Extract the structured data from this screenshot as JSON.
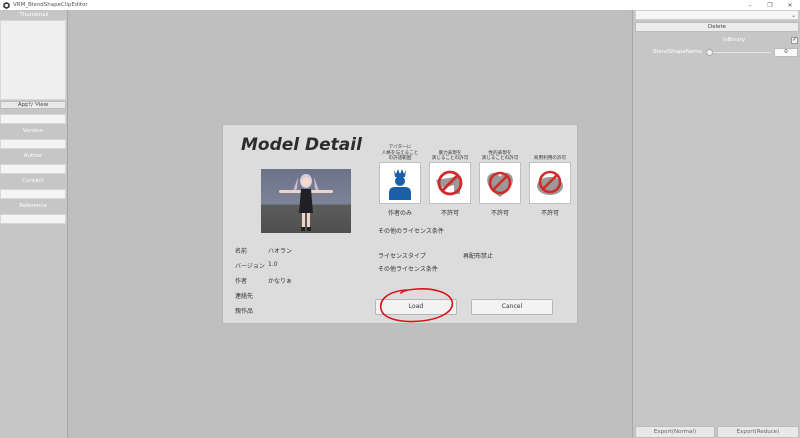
{
  "window": {
    "title": "VRM_BlendShapeClipEditor",
    "min": "–",
    "max": "❐",
    "close": "✕"
  },
  "left_panel": {
    "thumbnail_label": "Thumbnail",
    "apply_view": "Apply View",
    "fields": [
      "Title",
      "Version",
      "Author",
      "Contact",
      "Reference"
    ]
  },
  "right_panel": {
    "dropdown_value": "",
    "delete_label": "Delete",
    "is_binary_label": "IsBinary",
    "is_binary_checked": "✓",
    "blendshape_name_label": "BlendShapeName",
    "slider_value": "0",
    "export_normal": "Export(Normal)",
    "export_reduce": "Export(Reduce)"
  },
  "modal": {
    "title": "Model Detail",
    "info": [
      {
        "label": "名前",
        "value": "ハオラン"
      },
      {
        "label": "バージョン",
        "value": "1.0"
      },
      {
        "label": "作者",
        "value": "かなりぁ"
      },
      {
        "label": "連絡先",
        "value": ""
      },
      {
        "label": "親作品",
        "value": ""
      }
    ],
    "permissions": [
      {
        "title": "アバターに\n人格を与えること\nの許諾範囲",
        "value": "作者のみ",
        "icon": "avatar-person-icon"
      },
      {
        "title": "暴力表現を\n演じることの許可",
        "value": "不許可",
        "icon": "no-violence-icon"
      },
      {
        "title": "性的表現を\n演じることの許可",
        "value": "不許可",
        "icon": "no-sexual-icon"
      },
      {
        "title": "商用利用の許可",
        "value": "不許可",
        "icon": "no-commercial-icon"
      }
    ],
    "other_license_top": "その他のライセンス条件",
    "license_type_label": "ライセンスタイプ",
    "license_type_value": "再配布禁止",
    "other_license_bottom": "その他ライセンス条件",
    "load_label": "Load",
    "cancel_label": "Cancel"
  },
  "colors": {
    "avatar_blue": "#1b5fa8",
    "prohibit_red": "#d12a2a"
  }
}
